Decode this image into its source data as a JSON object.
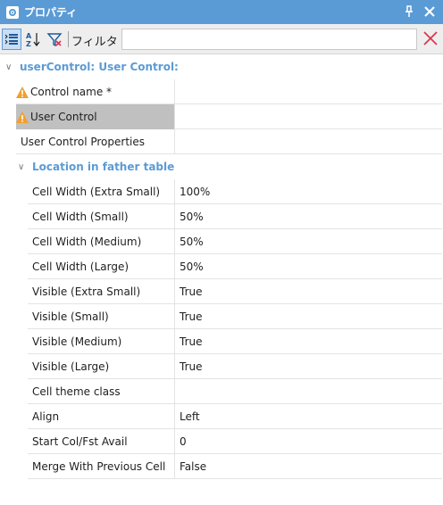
{
  "window": {
    "title": "プロパティ"
  },
  "toolbar": {
    "filter_label": "フィルタ",
    "filter_value": ""
  },
  "section": {
    "title": "userControl: User Control:"
  },
  "top_properties": [
    {
      "name": "Control name *",
      "value": "",
      "warning": true
    },
    {
      "name": "User Control",
      "value": "",
      "warning": true,
      "selected": true
    },
    {
      "name": "User Control Properties",
      "value": ""
    }
  ],
  "subsection": {
    "title": "Location in father table"
  },
  "properties": [
    {
      "name": "Cell Width (Extra Small)",
      "value": "100%"
    },
    {
      "name": "Cell Width (Small)",
      "value": "50%"
    },
    {
      "name": "Cell Width (Medium)",
      "value": "50%"
    },
    {
      "name": "Cell Width (Large)",
      "value": "50%"
    },
    {
      "name": "Visible (Extra Small)",
      "value": "True"
    },
    {
      "name": "Visible (Small)",
      "value": "True"
    },
    {
      "name": "Visible (Medium)",
      "value": "True"
    },
    {
      "name": "Visible (Large)",
      "value": "True"
    },
    {
      "name": "Cell theme class",
      "value": ""
    },
    {
      "name": "Align",
      "value": "Left"
    },
    {
      "name": "Start Col/Fst Avail",
      "value": "0"
    },
    {
      "name": "Merge With Previous Cell",
      "value": "False"
    }
  ],
  "colors": {
    "accent": "#5b9bd5",
    "warning": "#f0a030",
    "clear": "#e0344c",
    "selected": "#c0c0c0"
  }
}
